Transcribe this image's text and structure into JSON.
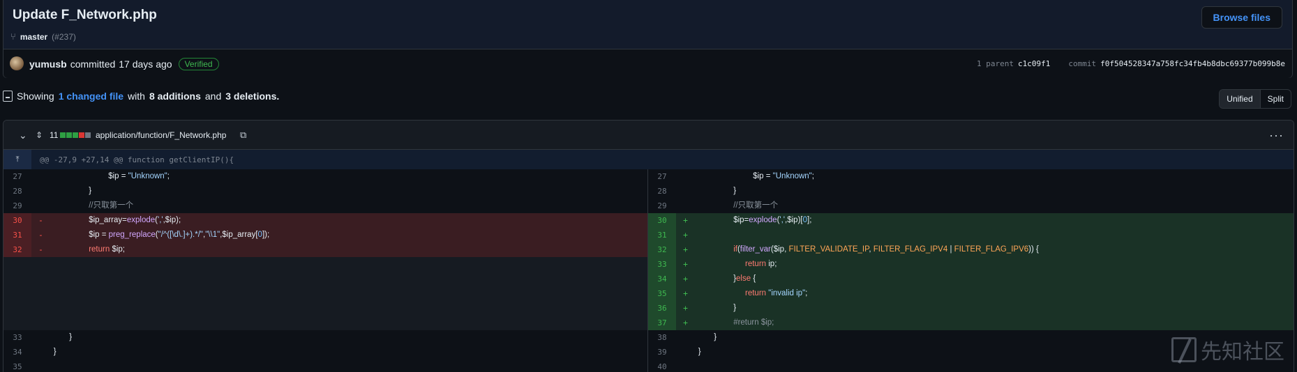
{
  "commit": {
    "title": "Update F_Network.php",
    "branch": "master",
    "pr": "(#237)",
    "browse_label": "Browse files",
    "author": "yumusb",
    "action": "committed",
    "time": "17 days ago",
    "verified": "Verified",
    "parent_label": "1 parent",
    "parent_sha": "c1c09f1",
    "commit_label": "commit",
    "commit_sha": "f0f504528347a758fc34fb4b8dbc69377b099b8e"
  },
  "summary": {
    "showing": "Showing",
    "changed": "1 changed file",
    "with": "with",
    "additions": "8 additions",
    "and": "and",
    "deletions": "3 deletions."
  },
  "view_toggle": {
    "unified": "Unified",
    "split": "Split"
  },
  "file": {
    "count": "11",
    "path": "application/function/F_Network.php",
    "blocks": [
      "#2ea043",
      "#2ea043",
      "#2ea043",
      "#da3633",
      "#6e7681"
    ],
    "hunk": "@@ -27,9 +27,14 @@ function getClientIP(){"
  },
  "left_lines": [
    {
      "n": "27",
      "t": "ctx",
      "i": 17,
      "c": "$ip = \"Unknown\";"
    },
    {
      "n": "28",
      "t": "ctx",
      "i": 12,
      "c": "}"
    },
    {
      "n": "29",
      "t": "ctx",
      "i": 12,
      "c": "//只取第一个"
    },
    {
      "n": "30",
      "t": "del",
      "i": 12,
      "c": "$ip_array=explode(',',$ip);"
    },
    {
      "n": "31",
      "t": "del",
      "i": 12,
      "c": "$ip = preg_replace(\"/^([\\d\\.]+).*/\",\"\\\\1\",$ip_array[0]);"
    },
    {
      "n": "32",
      "t": "del",
      "i": 12,
      "c": "return $ip;"
    },
    {
      "n": "",
      "t": "blank",
      "i": 0,
      "c": ""
    },
    {
      "n": "",
      "t": "blank",
      "i": 0,
      "c": ""
    },
    {
      "n": "",
      "t": "blank",
      "i": 0,
      "c": ""
    },
    {
      "n": "",
      "t": "blank",
      "i": 0,
      "c": ""
    },
    {
      "n": "",
      "t": "blank",
      "i": 0,
      "c": ""
    },
    {
      "n": "33",
      "t": "ctx",
      "i": 7,
      "c": "}"
    },
    {
      "n": "34",
      "t": "ctx",
      "i": 3,
      "c": "}"
    },
    {
      "n": "35",
      "t": "ctx",
      "i": 0,
      "c": ""
    }
  ],
  "right_lines": [
    {
      "n": "27",
      "t": "ctx",
      "i": 17,
      "c": "$ip = \"Unknown\";"
    },
    {
      "n": "28",
      "t": "ctx",
      "i": 12,
      "c": "}"
    },
    {
      "n": "29",
      "t": "ctx",
      "i": 12,
      "c": "//只取第一个"
    },
    {
      "n": "30",
      "t": "add",
      "i": 12,
      "c": "$ip=explode(',',$ip)[0];"
    },
    {
      "n": "31",
      "t": "add",
      "i": 12,
      "c": ""
    },
    {
      "n": "32",
      "t": "add",
      "i": 12,
      "c": "if(filter_var($ip, FILTER_VALIDATE_IP, FILTER_FLAG_IPV4 | FILTER_FLAG_IPV6)) {"
    },
    {
      "n": "33",
      "t": "add",
      "i": 15,
      "c": "return ip;"
    },
    {
      "n": "34",
      "t": "add",
      "i": 12,
      "c": "}else {"
    },
    {
      "n": "35",
      "t": "add",
      "i": 15,
      "c": "return \"invalid ip\";"
    },
    {
      "n": "36",
      "t": "add",
      "i": 12,
      "c": "}"
    },
    {
      "n": "37",
      "t": "add",
      "i": 12,
      "c": "#return $ip;"
    },
    {
      "n": "38",
      "t": "ctx",
      "i": 7,
      "c": "}"
    },
    {
      "n": "39",
      "t": "ctx",
      "i": 3,
      "c": "}"
    },
    {
      "n": "40",
      "t": "ctx",
      "i": 0,
      "c": ""
    }
  ],
  "watermark": "先知社区"
}
